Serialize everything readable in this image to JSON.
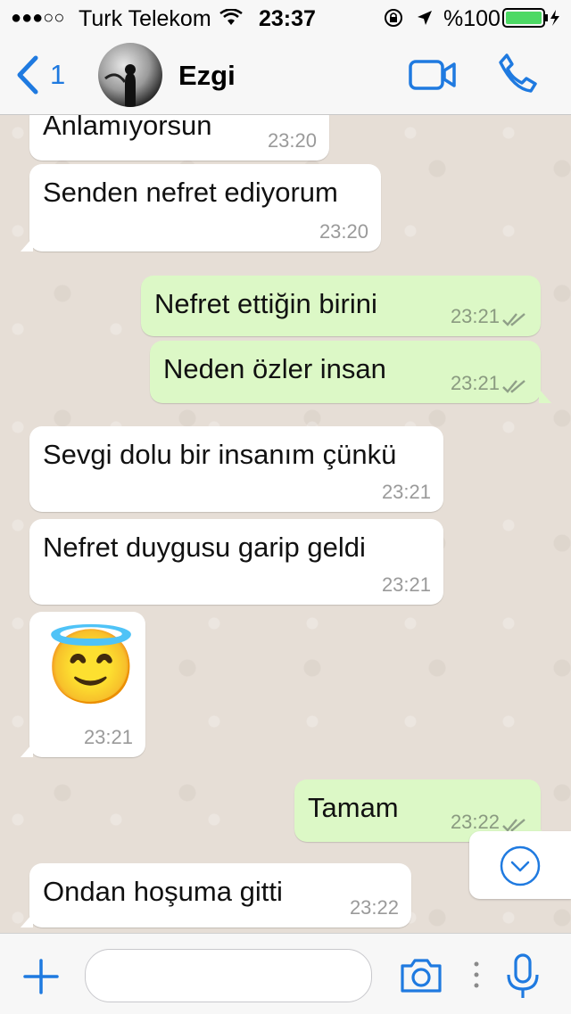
{
  "status": {
    "signal": "●●●○○",
    "carrier": "Turk Telekom",
    "time": "23:37",
    "battery": "%100"
  },
  "header": {
    "back_count": "1",
    "contact_name": "Ezgi",
    "icons": [
      "back-chevron-icon",
      "video-call-icon",
      "phone-icon"
    ]
  },
  "messages": [
    {
      "dir": "in",
      "text": "Anlamıyorsun",
      "time": "23:20"
    },
    {
      "dir": "in",
      "text": "Senden nefret ediyorum",
      "time": "23:20"
    },
    {
      "dir": "out",
      "text": "Nefret ettiğin birini",
      "time": "23:21",
      "status": "read"
    },
    {
      "dir": "out",
      "text": "Neden özler insan",
      "time": "23:21",
      "status": "read"
    },
    {
      "dir": "in",
      "text": "Sevgi dolu bir insanım çünkü",
      "time": "23:21"
    },
    {
      "dir": "in",
      "text": "Nefret duygusu garip geldi",
      "time": "23:21"
    },
    {
      "dir": "in",
      "emoji": "😇",
      "time": "23:21"
    },
    {
      "dir": "out",
      "text": "Tamam",
      "time": "23:22",
      "status": "read"
    },
    {
      "dir": "in",
      "text": "Ondan hoşuma gitti",
      "time": "23:22"
    }
  ],
  "input": {
    "placeholder": "",
    "icons": [
      "plus-icon",
      "camera-icon",
      "microphone-icon"
    ]
  },
  "colors": {
    "accent": "#1f7ae0",
    "incoming_bubble": "#ffffff",
    "outgoing_bubble": "#dcf8c6",
    "chat_background": "#e6ded6"
  }
}
